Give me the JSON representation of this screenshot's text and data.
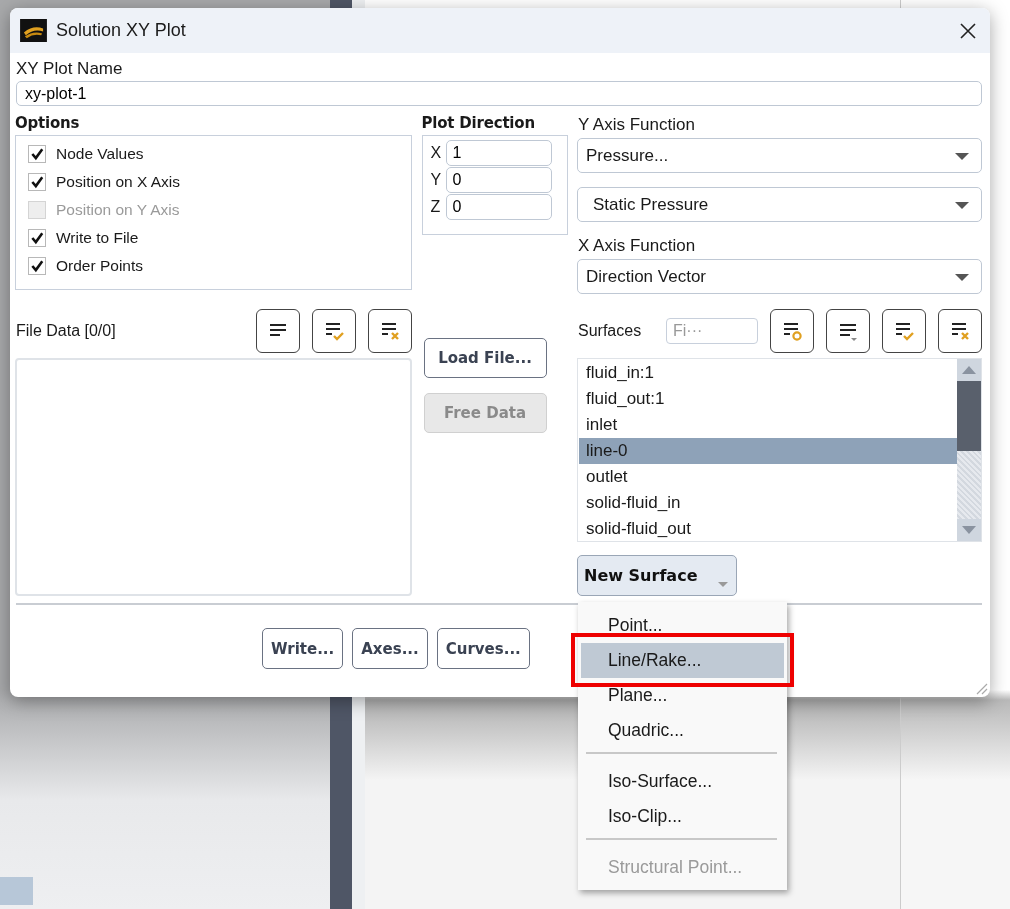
{
  "dialog": {
    "title": "Solution XY Plot",
    "name_label": "XY Plot Name",
    "name_value": "xy-plot-1",
    "options": {
      "title": "Options",
      "items": [
        {
          "label": "Node Values",
          "checked": true,
          "disabled": false
        },
        {
          "label": "Position on X Axis",
          "checked": true,
          "disabled": false
        },
        {
          "label": "Position on Y Axis",
          "checked": false,
          "disabled": true
        },
        {
          "label": "Write to File",
          "checked": true,
          "disabled": false
        },
        {
          "label": "Order Points",
          "checked": true,
          "disabled": false
        }
      ]
    },
    "plot_direction": {
      "title": "Plot Direction",
      "fields": [
        {
          "axis": "X",
          "value": "1"
        },
        {
          "axis": "Y",
          "value": "0"
        },
        {
          "axis": "Z",
          "value": "0"
        }
      ]
    },
    "y_axis": {
      "label": "Y Axis Function",
      "category": "Pressure...",
      "quantity": "Static Pressure"
    },
    "x_axis": {
      "label": "X Axis Function",
      "value": "Direction Vector"
    },
    "file_data": {
      "label": "File Data [0/0]"
    },
    "file_buttons": [
      {
        "label": "Load File...",
        "disabled": false
      },
      {
        "label": "Free Data",
        "disabled": true
      }
    ],
    "surfaces": {
      "label": "Surfaces",
      "filter_placeholder": "Fi···",
      "items": [
        {
          "name": "fluid_in:1",
          "selected": false
        },
        {
          "name": "fluid_out:1",
          "selected": false
        },
        {
          "name": "inlet",
          "selected": false
        },
        {
          "name": "line-0",
          "selected": true
        },
        {
          "name": "outlet",
          "selected": false
        },
        {
          "name": "solid-fluid_in",
          "selected": false
        },
        {
          "name": "solid-fluid_out",
          "selected": false
        }
      ]
    },
    "new_surface": "New Surface",
    "buttons": [
      "Write...",
      "Axes...",
      "Curves..."
    ]
  },
  "menu": {
    "items": [
      {
        "kind": "item",
        "label": "Point...",
        "selected": false,
        "disabled": false
      },
      {
        "kind": "item",
        "label": "Line/Rake...",
        "selected": true,
        "disabled": false
      },
      {
        "kind": "item",
        "label": "Plane...",
        "selected": false,
        "disabled": false
      },
      {
        "kind": "item",
        "label": "Quadric...",
        "selected": false,
        "disabled": false
      },
      {
        "kind": "separator"
      },
      {
        "kind": "item",
        "label": "Iso-Surface...",
        "selected": false,
        "disabled": false
      },
      {
        "kind": "item",
        "label": "Iso-Clip...",
        "selected": false,
        "disabled": false
      },
      {
        "kind": "separator"
      },
      {
        "kind": "item",
        "label": "Structural Point...",
        "selected": false,
        "disabled": true
      }
    ]
  }
}
